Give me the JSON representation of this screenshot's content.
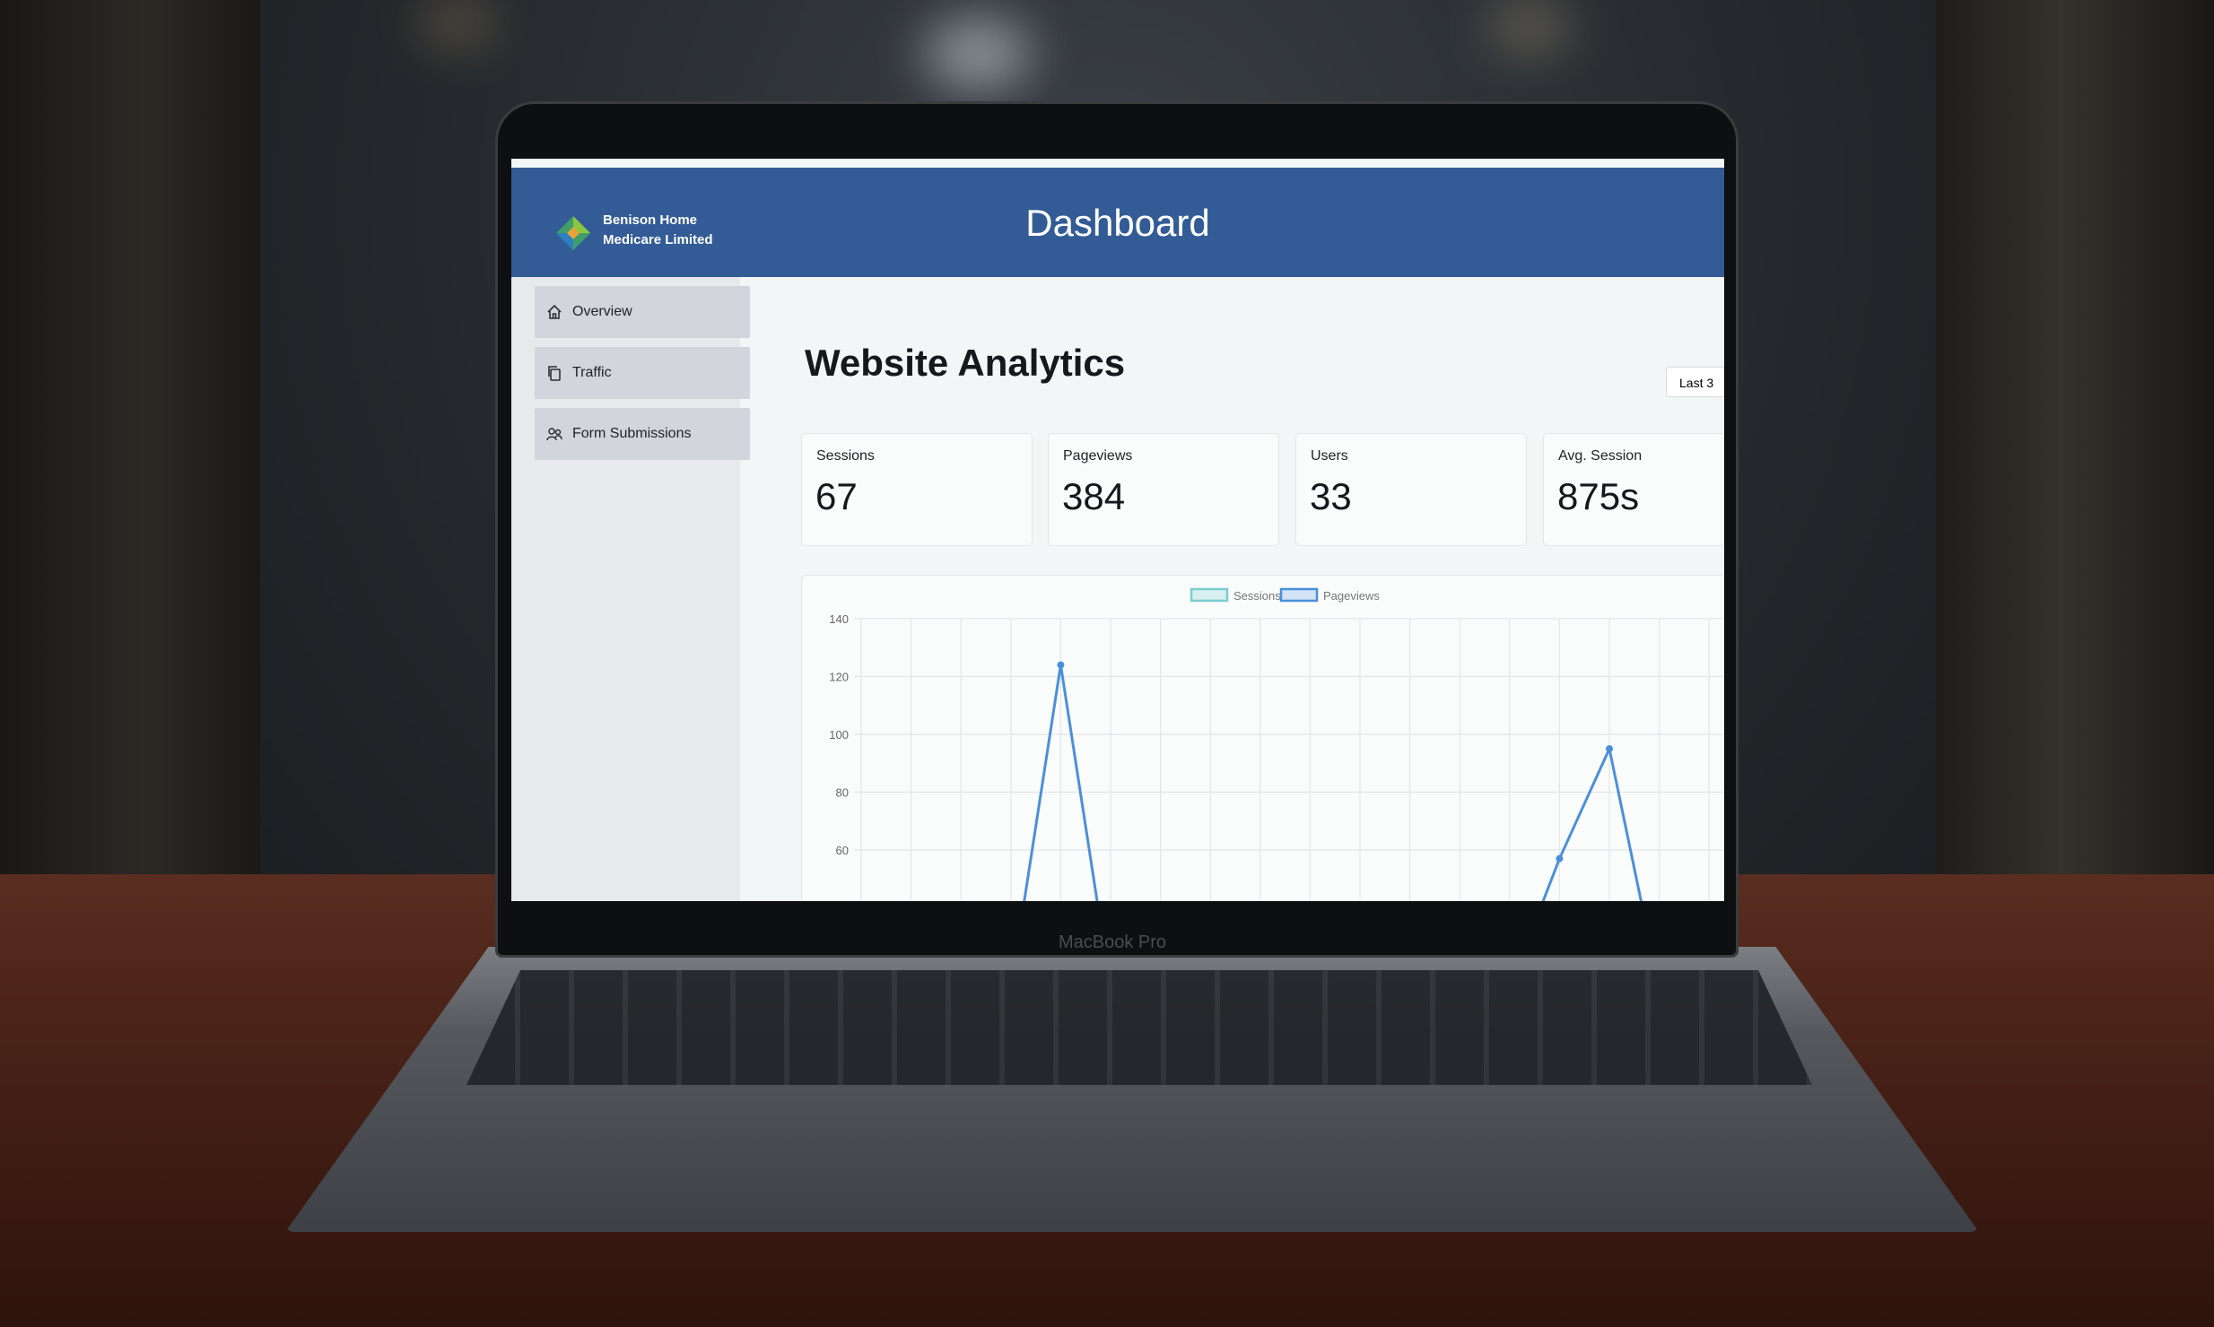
{
  "brand": {
    "line1": "Benison Home",
    "line2": "Medicare Limited"
  },
  "header": {
    "title": "Dashboard"
  },
  "sidebar": {
    "items": [
      {
        "label": "Overview",
        "icon": "home-icon"
      },
      {
        "label": "Traffic",
        "icon": "copy-icon"
      },
      {
        "label": "Form Submissions",
        "icon": "users-icon"
      }
    ]
  },
  "main": {
    "title": "Website Analytics",
    "range_label": "Last 3"
  },
  "stats": [
    {
      "label": "Sessions",
      "value": "67"
    },
    {
      "label": "Pageviews",
      "value": "384"
    },
    {
      "label": "Users",
      "value": "33"
    },
    {
      "label": "Avg. Session",
      "value": "875s"
    }
  ],
  "laptop": {
    "model": "MacBook Pro"
  },
  "colors": {
    "header": "#335c96",
    "sessions": "#7ccdcf",
    "pageviews": "#4a90d9"
  },
  "chart_data": {
    "type": "line",
    "legend": [
      "Sessions",
      "Pageviews"
    ],
    "legend_position": "top-center",
    "y_ticks": [
      140,
      120,
      100,
      80,
      60
    ],
    "ylim": [
      40,
      140
    ],
    "grid": true,
    "series": [
      {
        "name": "Pageviews",
        "values": [
          null,
          null,
          null,
          null,
          124,
          null,
          null,
          null,
          null,
          null,
          null,
          null,
          null,
          null,
          57,
          95,
          null,
          null
        ]
      }
    ]
  }
}
